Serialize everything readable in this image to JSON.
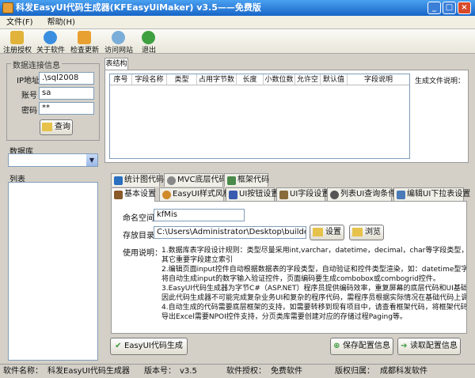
{
  "window": {
    "title": "科发EasyUI代码生成器(KFEasyUiMaker) v3.5——免费版"
  },
  "menu": {
    "file": "文件(F)",
    "help": "帮助(H)"
  },
  "toolbar": {
    "register": "注册授权",
    "about": "关于软件",
    "update": "检查更新",
    "website": "访问网站",
    "exit": "退出"
  },
  "db": {
    "group": "数据连接信息",
    "ip_label": "IP地址",
    "ip_value": ".\\sql2008",
    "user_label": "账号",
    "user_value": "sa",
    "pwd_label": "密码",
    "pwd_value": "**",
    "query": "查询"
  },
  "database": {
    "label": "数据库",
    "value": ""
  },
  "list": {
    "label": "列表"
  },
  "table": {
    "tab": "表结构",
    "columns": [
      "序号",
      "字段名称",
      "类型",
      "占用字节数",
      "长度",
      "小数位数",
      "允许空",
      "默认值",
      "字段说明"
    ]
  },
  "gen_desc": {
    "label": "生成文件说明："
  },
  "tabs_top": [
    "统计图代码",
    "MVC底层代码",
    "框架代码"
  ],
  "tabs_bottom": [
    "基本设置",
    "EasyUI样式风格",
    "UI按钮设置",
    "UI字段设置",
    "列表UI查询条件",
    "编辑UI下拉表设置"
  ],
  "settings": {
    "ns_label": "命名空间",
    "ns_value": "kfMis",
    "dir_label": "存放目录",
    "dir_value": "C:\\Users\\Administrator\\Desktop\\builder\\",
    "set_btn": "设置",
    "browse_btn": "浏览",
    "usage_label": "使用说明：",
    "notes": [
      "1.数据库表字段设计规则：类型尽量采用int,varchar，datetime，decimal，char等字段类型，主键建议采用va",
      "其它重要字段建立索引",
      "2.编辑页面input控件自动根据数据表的字段类型，自动验证和控件类型渲染，如：datetime型字段将自动生成E",
      "将自动生成input的数字输入验证控件，页面编码要生成combobox或combogrid控件。",
      "3.EasyUI代码生成器为字节C#（ASP.NET）程序员提供编码效率，重复屏幕的底层代码和UI基础代码交给生成器",
      "因此代码生成器不可能完成复杂业务UI和复杂的程序代码，需程序员根据实际情况在基础代码上调整。",
      "4.自动生成的代码需要底层框架的支持，如需要转移到现有项目中，请查看框架代码，将框架代码引用到您的项目",
      "导出Excel需要NPOI控件支持，分页类库需要创建对应的存储过程Paging等。"
    ]
  },
  "actions": {
    "generate": "EasyUI代码生成",
    "save": "保存配置信息",
    "load": "读取配置信息"
  },
  "status": {
    "name_label": "软件名称：",
    "name_value": "科发EasyUI代码生成器",
    "ver_label": "版本号：",
    "ver_value": "v3.5",
    "auth_label": "软件授权：",
    "auth_value": "免费软件",
    "copy_label": "版权归属：",
    "copy_value": "成都科发软件"
  }
}
